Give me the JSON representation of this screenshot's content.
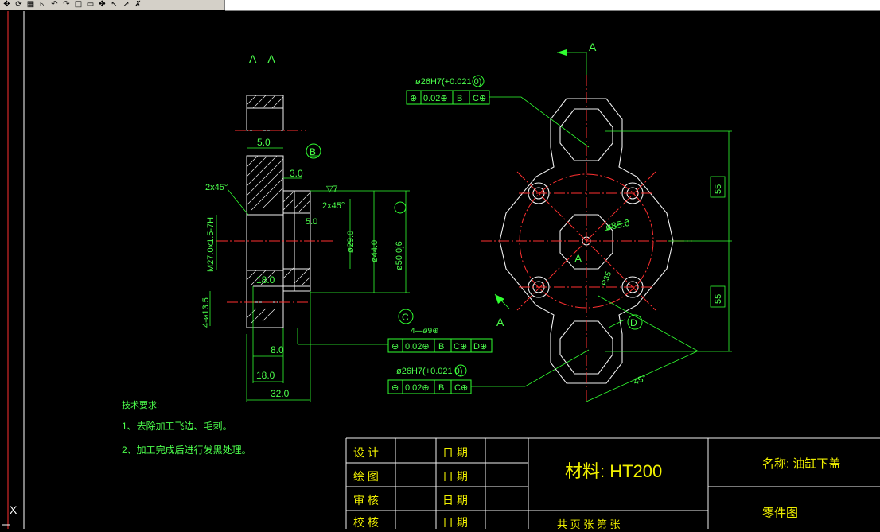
{
  "toolbar": {
    "icons": [
      "pan-icon",
      "orbit-icon",
      "grid-icon",
      "measure-icon",
      "undo-icon",
      "redo-icon",
      "window-icon",
      "window-icon-2",
      "tools-icon",
      "cursor-icon",
      "cursor-icon-2",
      "snap-icon"
    ]
  },
  "drawing": {
    "section_label": "A—A",
    "view_arrow_label_top": "A",
    "view_arrow_label_bottom": "A",
    "center_label": "A",
    "dims": {
      "d5": "5.0",
      "d3": "3.0",
      "chamfer1": "2x45°",
      "chamfer2": "2x45°",
      "rough": "▽7",
      "d5b": "5.0",
      "d13": "13.5",
      "thread": "M27.0x1.5-7H",
      "d18a": "18.0",
      "phi13": "4-ø13.5",
      "d8": "8.0",
      "d18b": "18.0",
      "d32": "32.0",
      "phi29": "ø29.0",
      "phi44": "ø44.0",
      "phi50": "ø50.0j6",
      "phi85": "ø85.0",
      "r35": "R35",
      "h55a": "55",
      "h55b": "55",
      "ang45": "45°",
      "holes4": "4—ø9⊕",
      "bore1": "ø26H7(+0.021 0)",
      "bore2": "ø26H7(+0.021 0)"
    },
    "datums": {
      "b": "B",
      "c": "C",
      "d": "D",
      "e": "E",
      "f": "F"
    },
    "fcf_top": [
      "⊕",
      "0.02⊕",
      "B",
      "C⊕"
    ],
    "fcf_mid": [
      "⊕",
      "0.02⊕",
      "B",
      "C⊕",
      "D⊕"
    ],
    "fcf_bot": [
      "⊕",
      "0.02⊕",
      "B",
      "C⊕"
    ],
    "notes": {
      "title": "技术要求:",
      "n1": "1、去除加工飞边、毛刺。",
      "n2": "2、加工完成后进行发黑处理。"
    }
  },
  "titleblock": {
    "rows": [
      {
        "role": "设  计",
        "date": "日  期"
      },
      {
        "role": "绘  图",
        "date": "日  期"
      },
      {
        "role": "审  核",
        "date": "日  期"
      },
      {
        "role": "校  核",
        "date": "日  期"
      }
    ],
    "material": "材料: HT200",
    "name": "名称: 油缸下盖",
    "type": "零件图",
    "sheet": "共  页  张    第  张"
  }
}
